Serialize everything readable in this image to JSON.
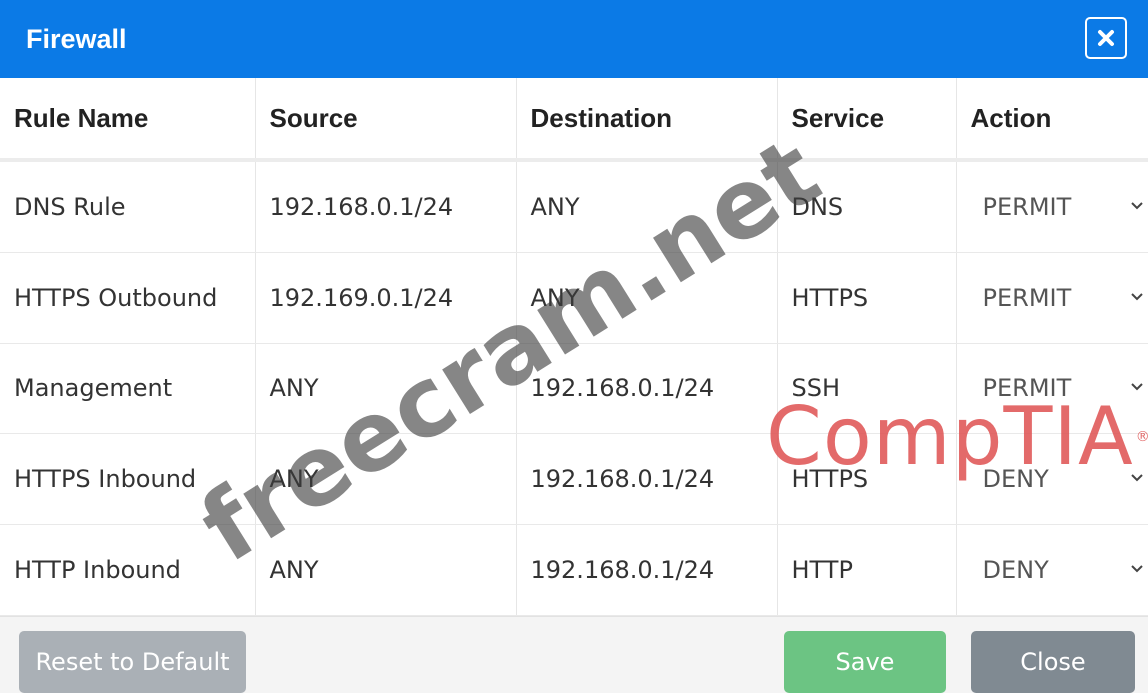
{
  "dialog": {
    "title": "Firewall",
    "close_icon": "close-icon",
    "accent_color": "#0b7ae6"
  },
  "table": {
    "headers": [
      "Rule Name",
      "Source",
      "Destination",
      "Service",
      "Action"
    ],
    "rows": [
      {
        "rule_name": "DNS Rule",
        "source": "192.168.0.1/24",
        "destination": "ANY",
        "service": "DNS",
        "action": "PERMIT"
      },
      {
        "rule_name": "HTTPS Outbound",
        "source": "192.169.0.1/24",
        "destination": "ANY",
        "service": "HTTPS",
        "action": "PERMIT"
      },
      {
        "rule_name": "Management",
        "source": "ANY",
        "destination": "192.168.0.1/24",
        "service": "SSH",
        "action": "PERMIT"
      },
      {
        "rule_name": "HTTPS Inbound",
        "source": "ANY",
        "destination": "192.168.0.1/24",
        "service": "HTTPS",
        "action": "DENY"
      },
      {
        "rule_name": "HTTP Inbound",
        "source": "ANY",
        "destination": "192.168.0.1/24",
        "service": "HTTP",
        "action": "DENY"
      }
    ]
  },
  "footer": {
    "reset_label": "Reset to Default",
    "save_label": "Save",
    "close_label": "Close",
    "save_color": "#6cc483"
  },
  "watermarks": {
    "site": "freecram.net",
    "brand": "CompTIA",
    "brand_mark": "®"
  }
}
